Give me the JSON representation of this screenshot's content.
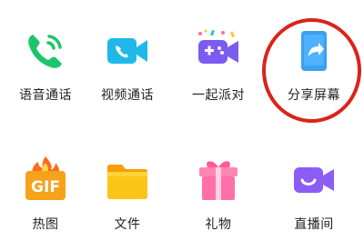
{
  "features": {
    "voice_call": {
      "label": "语音通话",
      "icon": "phone-icon"
    },
    "video_call": {
      "label": "视频通话",
      "icon": "video-call-icon"
    },
    "watch_together": {
      "label": "一起派对",
      "icon": "party-game-icon"
    },
    "share_screen": {
      "label": "分享屏幕",
      "icon": "share-screen-icon"
    },
    "gif": {
      "label": "热图",
      "icon": "gif-fire-icon",
      "badge": "GIF"
    },
    "file": {
      "label": "文件",
      "icon": "folder-icon"
    },
    "gift": {
      "label": "礼物",
      "icon": "gift-icon"
    },
    "live": {
      "label": "直播间",
      "icon": "live-room-icon"
    }
  },
  "annotation": {
    "color": "#d9241b",
    "target": "share_screen"
  },
  "colors": {
    "green": "#1fc46a",
    "cyan": "#1fb8e8",
    "purple": "#7a5cf0",
    "blue": "#3aa0f0",
    "orange": "#f7a21b",
    "yellow": "#fcc419",
    "pink": "#ff6fa8",
    "violet": "#8b5cf6"
  }
}
